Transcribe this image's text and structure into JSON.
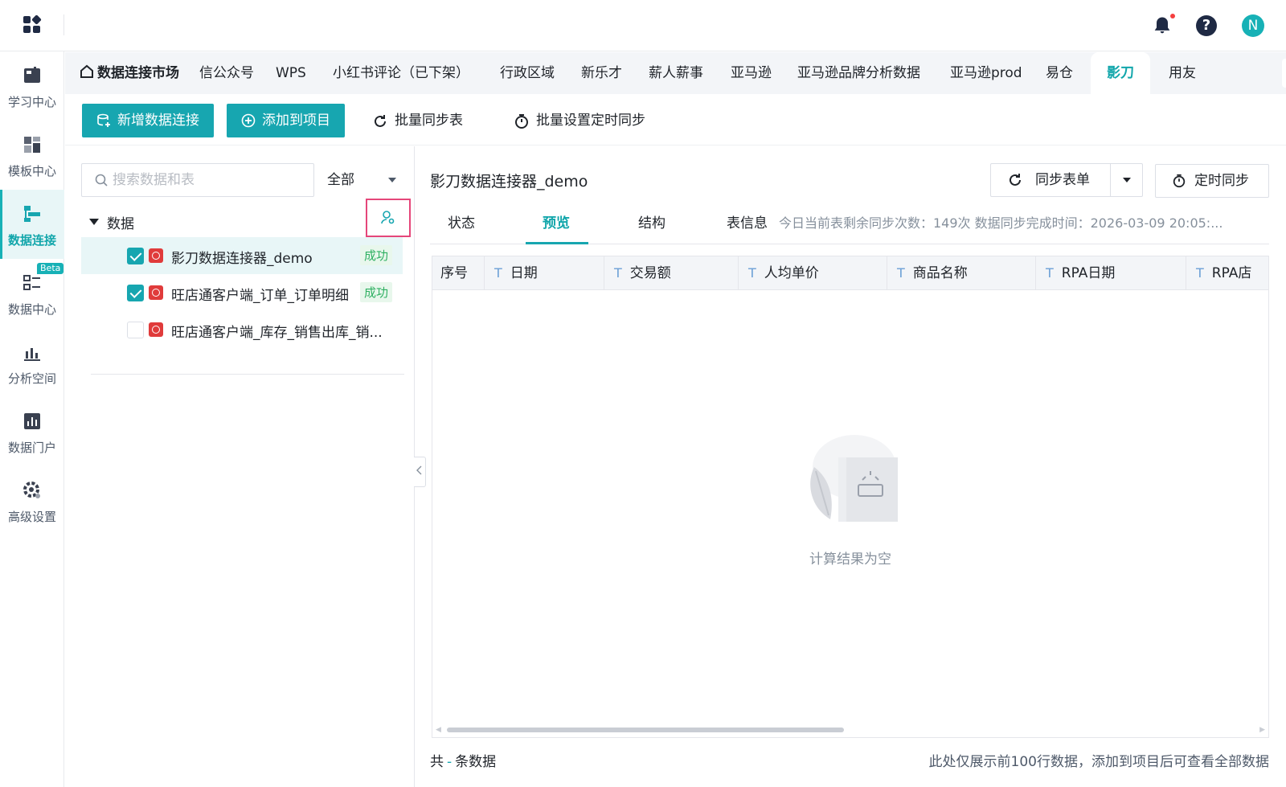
{
  "topbar": {
    "icons": [
      "apps-grid-icon",
      "bell-icon",
      "help-icon"
    ],
    "help_glyph": "?",
    "avatar_letter": "N"
  },
  "nav": {
    "items": [
      {
        "label": "学习中心",
        "icon": "learning-icon"
      },
      {
        "label": "模板中心",
        "icon": "template-icon"
      },
      {
        "label": "数据连接",
        "icon": "data-connect-icon",
        "active": true
      },
      {
        "label": "数据中心",
        "icon": "data-center-icon",
        "badge": "Beta"
      },
      {
        "label": "分析空间",
        "icon": "analysis-icon"
      },
      {
        "label": "数据门户",
        "icon": "portal-icon"
      },
      {
        "label": "高级设置",
        "icon": "settings-icon"
      }
    ]
  },
  "tabs": {
    "home": "数据连接市场",
    "items": [
      "信公众号",
      "WPS",
      "小红书评论（已下架）",
      "行政区域",
      "新乐才",
      "薪人薪事",
      "亚马逊",
      "亚马逊品牌分析数据",
      "亚马逊prod",
      "易仓",
      "影刀",
      "用友"
    ],
    "active": "影刀",
    "more_glyph": "⌄"
  },
  "toolbar": {
    "new_connection": "新增数据连接",
    "add_to_project": "添加到项目",
    "batch_sync": "批量同步表",
    "batch_schedule": "批量设置定时同步"
  },
  "left": {
    "search_placeholder": "搜索数据和表",
    "filter_value": "全部",
    "root_label": "数据",
    "rows": [
      {
        "label": "影刀数据连接器_demo",
        "checked": true,
        "status": "成功",
        "selected": true
      },
      {
        "label": "旺店通客户端_订单_订单明细",
        "checked": true,
        "status": "成功"
      },
      {
        "label": "旺店通客户端_库存_销售出库_销...",
        "checked": false,
        "status": ""
      }
    ]
  },
  "content": {
    "title": "影刀数据连接器_demo",
    "sync_button": "同步表单",
    "timer_button": "定时同步",
    "tabs": [
      "状态",
      "预览",
      "结构"
    ],
    "active_tab": "预览",
    "info_label": "表信息",
    "info_text": "今日当前表剩余同步次数：149次   数据同步完成时间：2026-03-09 20:05:...",
    "columns": [
      "序号",
      "日期",
      "交易额",
      "人均单价",
      "商品名称",
      "RPA日期",
      "RPA店"
    ],
    "column_type_glyph": "T",
    "empty_text": "计算结果为空",
    "footer_total_prefix": "共",
    "footer_total_value": "-",
    "footer_total_suffix": "条数据",
    "footer_note": "此处仅展示前100行数据，添加到项目后可查看全部数据"
  },
  "colors": {
    "accent": "#17a6b0",
    "accent_text": "#12a6ab",
    "success": "#2fb062",
    "highlight_border": "#e5467a"
  }
}
